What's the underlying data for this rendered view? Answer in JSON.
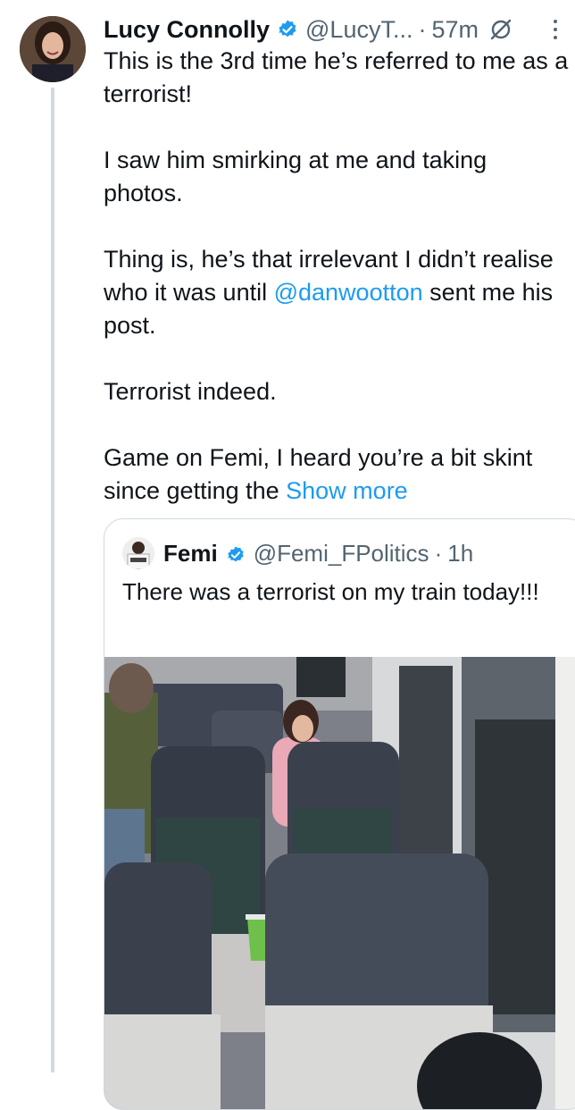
{
  "post": {
    "author_name": "Lucy Connolly",
    "handle": "@LucyT...",
    "separator": "·",
    "time": "57m",
    "paragraphs": [
      "This is the 3rd time he’s referred to me as a terrorist!",
      "I saw him smirking at me and taking photos.",
      "Terrorist indeed."
    ],
    "p3_before": "Thing is, he’s that irrelevant I didn’t realise who it was until ",
    "p3_mention": "@danwootton",
    "p3_after": " sent me his post.",
    "p5_text": "Game on Femi, I heard you’re a bit skint since getting the ",
    "show_more": "Show more"
  },
  "quoted": {
    "author_name": "Femi",
    "handle": "@Femi_FPolitics",
    "separator": "·",
    "time": "1h",
    "text": "There was a terrorist on my train today!!!"
  },
  "colors": {
    "link": "#1d9bf0",
    "secondary_text": "#536471",
    "verified_badge": "#1d9bf0"
  },
  "icons": [
    "verified-badge-icon",
    "grok-icon",
    "more-options-icon"
  ]
}
